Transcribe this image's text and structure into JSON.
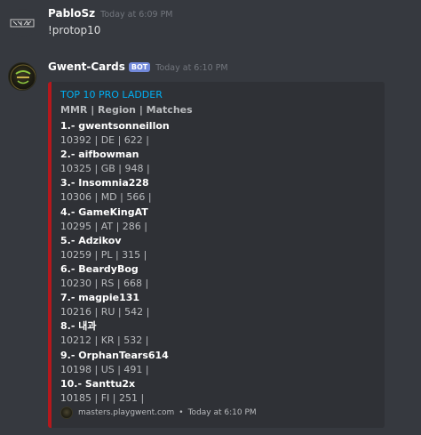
{
  "message1": {
    "username": "PabloSz",
    "timestamp": "Today at 6:09 PM",
    "content": "!protop10",
    "avatar_icon": "pablo-logo-icon"
  },
  "message2": {
    "username": "Gwent-Cards",
    "badge": "BOT",
    "timestamp": "Today at 6:10 PM",
    "avatar_icon": "gwent-logo-icon",
    "embed": {
      "accent_color": "#b5181c",
      "title": "TOP 10 PRO LADDER",
      "field_name": "MMR | Region | Matches",
      "entries": [
        {
          "name": "1.- gwentsonneillon",
          "stats": "10392 | DE | 622 |"
        },
        {
          "name": "2.- aifbowman",
          "stats": "10325 | GB | 948 |"
        },
        {
          "name": "3.- Insomnia228",
          "stats": "10306 | MD | 566 |"
        },
        {
          "name": "4.- GameKingAT",
          "stats": "10295 | AT | 286 |"
        },
        {
          "name": "5.- Adzikov",
          "stats": "10259 | PL | 315 |"
        },
        {
          "name": "6.- BeardyBog",
          "stats": "10230 | RS | 668 |"
        },
        {
          "name": "7.- magpie131",
          "stats": "10216 | RU | 542 |"
        },
        {
          "name": "8.- 내과",
          "stats": "10212 | KR | 532 |"
        },
        {
          "name": "9.- OrphanTears614",
          "stats": "10198 | US | 491 |"
        },
        {
          "name": "10.- Santtu2x",
          "stats": "10185 | FI | 251 |"
        }
      ],
      "footer": {
        "text": "masters.playgwent.com",
        "separator": "•",
        "timestamp": "Today at 6:10 PM",
        "icon": "gwent-footer-icon"
      }
    }
  }
}
